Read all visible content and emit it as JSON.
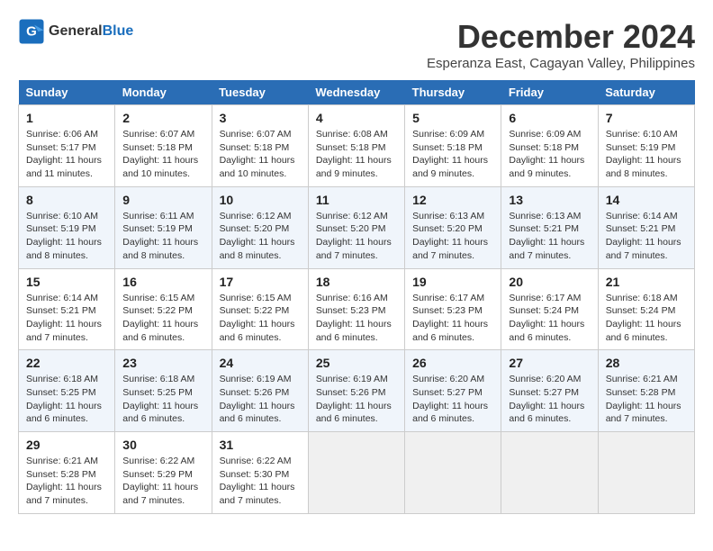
{
  "logo": {
    "general": "General",
    "blue": "Blue"
  },
  "title": "December 2024",
  "location": "Esperanza East, Cagayan Valley, Philippines",
  "days_header": [
    "Sunday",
    "Monday",
    "Tuesday",
    "Wednesday",
    "Thursday",
    "Friday",
    "Saturday"
  ],
  "weeks": [
    [
      {
        "num": "1",
        "sunrise": "Sunrise: 6:06 AM",
        "sunset": "Sunset: 5:17 PM",
        "daylight": "Daylight: 11 hours and 11 minutes."
      },
      {
        "num": "2",
        "sunrise": "Sunrise: 6:07 AM",
        "sunset": "Sunset: 5:18 PM",
        "daylight": "Daylight: 11 hours and 10 minutes."
      },
      {
        "num": "3",
        "sunrise": "Sunrise: 6:07 AM",
        "sunset": "Sunset: 5:18 PM",
        "daylight": "Daylight: 11 hours and 10 minutes."
      },
      {
        "num": "4",
        "sunrise": "Sunrise: 6:08 AM",
        "sunset": "Sunset: 5:18 PM",
        "daylight": "Daylight: 11 hours and 9 minutes."
      },
      {
        "num": "5",
        "sunrise": "Sunrise: 6:09 AM",
        "sunset": "Sunset: 5:18 PM",
        "daylight": "Daylight: 11 hours and 9 minutes."
      },
      {
        "num": "6",
        "sunrise": "Sunrise: 6:09 AM",
        "sunset": "Sunset: 5:18 PM",
        "daylight": "Daylight: 11 hours and 9 minutes."
      },
      {
        "num": "7",
        "sunrise": "Sunrise: 6:10 AM",
        "sunset": "Sunset: 5:19 PM",
        "daylight": "Daylight: 11 hours and 8 minutes."
      }
    ],
    [
      {
        "num": "8",
        "sunrise": "Sunrise: 6:10 AM",
        "sunset": "Sunset: 5:19 PM",
        "daylight": "Daylight: 11 hours and 8 minutes."
      },
      {
        "num": "9",
        "sunrise": "Sunrise: 6:11 AM",
        "sunset": "Sunset: 5:19 PM",
        "daylight": "Daylight: 11 hours and 8 minutes."
      },
      {
        "num": "10",
        "sunrise": "Sunrise: 6:12 AM",
        "sunset": "Sunset: 5:20 PM",
        "daylight": "Daylight: 11 hours and 8 minutes."
      },
      {
        "num": "11",
        "sunrise": "Sunrise: 6:12 AM",
        "sunset": "Sunset: 5:20 PM",
        "daylight": "Daylight: 11 hours and 7 minutes."
      },
      {
        "num": "12",
        "sunrise": "Sunrise: 6:13 AM",
        "sunset": "Sunset: 5:20 PM",
        "daylight": "Daylight: 11 hours and 7 minutes."
      },
      {
        "num": "13",
        "sunrise": "Sunrise: 6:13 AM",
        "sunset": "Sunset: 5:21 PM",
        "daylight": "Daylight: 11 hours and 7 minutes."
      },
      {
        "num": "14",
        "sunrise": "Sunrise: 6:14 AM",
        "sunset": "Sunset: 5:21 PM",
        "daylight": "Daylight: 11 hours and 7 minutes."
      }
    ],
    [
      {
        "num": "15",
        "sunrise": "Sunrise: 6:14 AM",
        "sunset": "Sunset: 5:21 PM",
        "daylight": "Daylight: 11 hours and 7 minutes."
      },
      {
        "num": "16",
        "sunrise": "Sunrise: 6:15 AM",
        "sunset": "Sunset: 5:22 PM",
        "daylight": "Daylight: 11 hours and 6 minutes."
      },
      {
        "num": "17",
        "sunrise": "Sunrise: 6:15 AM",
        "sunset": "Sunset: 5:22 PM",
        "daylight": "Daylight: 11 hours and 6 minutes."
      },
      {
        "num": "18",
        "sunrise": "Sunrise: 6:16 AM",
        "sunset": "Sunset: 5:23 PM",
        "daylight": "Daylight: 11 hours and 6 minutes."
      },
      {
        "num": "19",
        "sunrise": "Sunrise: 6:17 AM",
        "sunset": "Sunset: 5:23 PM",
        "daylight": "Daylight: 11 hours and 6 minutes."
      },
      {
        "num": "20",
        "sunrise": "Sunrise: 6:17 AM",
        "sunset": "Sunset: 5:24 PM",
        "daylight": "Daylight: 11 hours and 6 minutes."
      },
      {
        "num": "21",
        "sunrise": "Sunrise: 6:18 AM",
        "sunset": "Sunset: 5:24 PM",
        "daylight": "Daylight: 11 hours and 6 minutes."
      }
    ],
    [
      {
        "num": "22",
        "sunrise": "Sunrise: 6:18 AM",
        "sunset": "Sunset: 5:25 PM",
        "daylight": "Daylight: 11 hours and 6 minutes."
      },
      {
        "num": "23",
        "sunrise": "Sunrise: 6:18 AM",
        "sunset": "Sunset: 5:25 PM",
        "daylight": "Daylight: 11 hours and 6 minutes."
      },
      {
        "num": "24",
        "sunrise": "Sunrise: 6:19 AM",
        "sunset": "Sunset: 5:26 PM",
        "daylight": "Daylight: 11 hours and 6 minutes."
      },
      {
        "num": "25",
        "sunrise": "Sunrise: 6:19 AM",
        "sunset": "Sunset: 5:26 PM",
        "daylight": "Daylight: 11 hours and 6 minutes."
      },
      {
        "num": "26",
        "sunrise": "Sunrise: 6:20 AM",
        "sunset": "Sunset: 5:27 PM",
        "daylight": "Daylight: 11 hours and 6 minutes."
      },
      {
        "num": "27",
        "sunrise": "Sunrise: 6:20 AM",
        "sunset": "Sunset: 5:27 PM",
        "daylight": "Daylight: 11 hours and 6 minutes."
      },
      {
        "num": "28",
        "sunrise": "Sunrise: 6:21 AM",
        "sunset": "Sunset: 5:28 PM",
        "daylight": "Daylight: 11 hours and 7 minutes."
      }
    ],
    [
      {
        "num": "29",
        "sunrise": "Sunrise: 6:21 AM",
        "sunset": "Sunset: 5:28 PM",
        "daylight": "Daylight: 11 hours and 7 minutes."
      },
      {
        "num": "30",
        "sunrise": "Sunrise: 6:22 AM",
        "sunset": "Sunset: 5:29 PM",
        "daylight": "Daylight: 11 hours and 7 minutes."
      },
      {
        "num": "31",
        "sunrise": "Sunrise: 6:22 AM",
        "sunset": "Sunset: 5:30 PM",
        "daylight": "Daylight: 11 hours and 7 minutes."
      },
      null,
      null,
      null,
      null
    ]
  ]
}
